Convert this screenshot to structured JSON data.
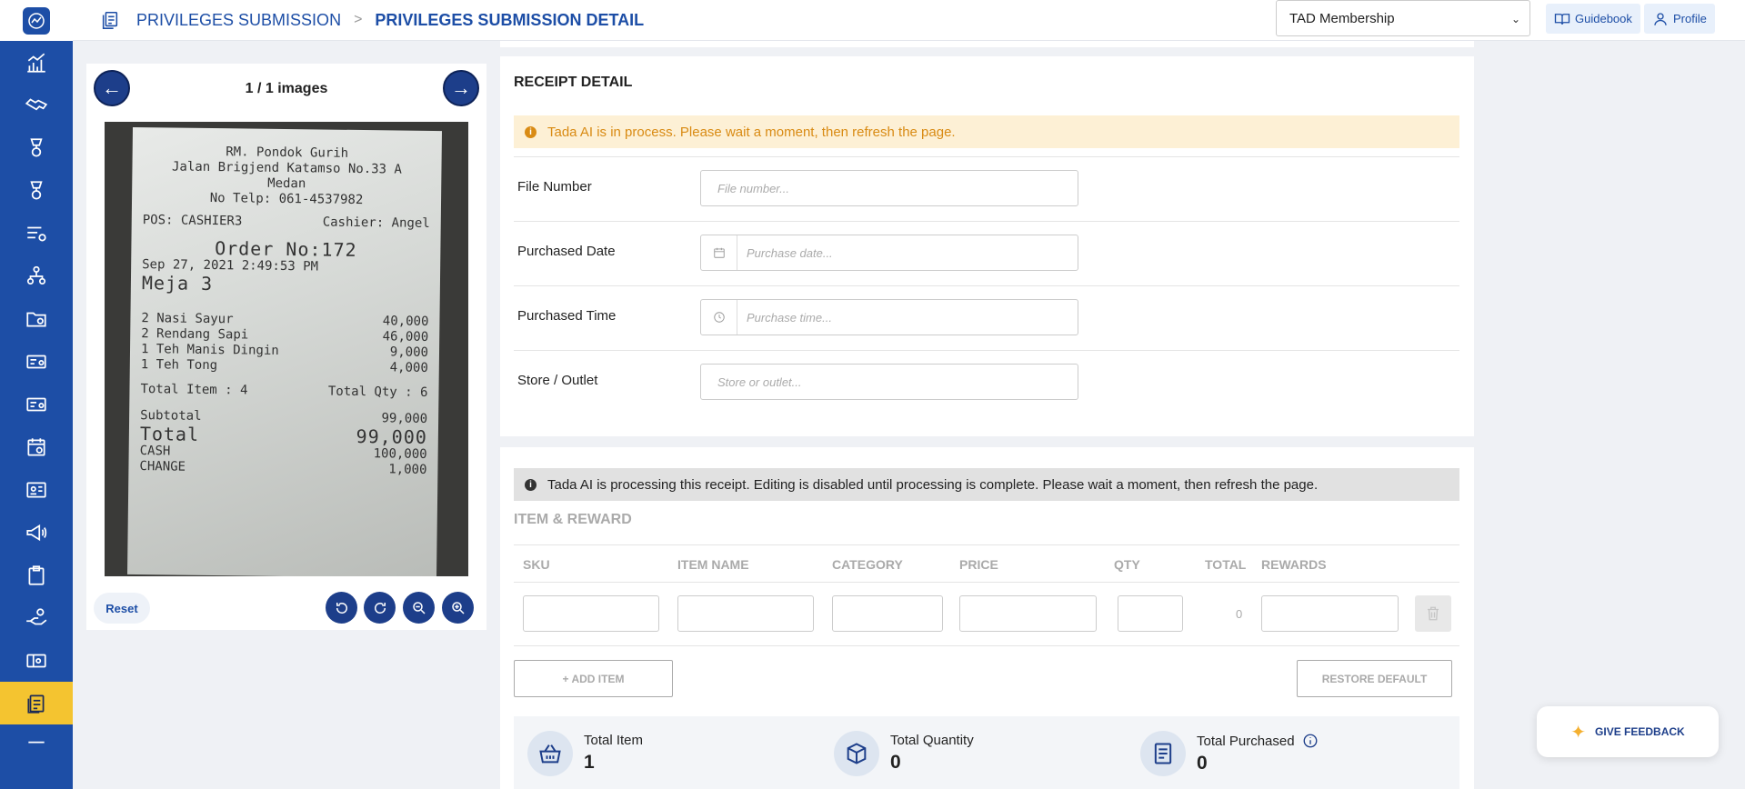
{
  "header": {
    "crumb1": "PRIVILEGES SUBMISSION",
    "separator": ">",
    "crumb2": "PRIVILEGES SUBMISSION DETAIL",
    "membership_selected": "TAD Membership",
    "guidebook_label": "Guidebook",
    "profile_label": "Profile"
  },
  "sidebar": {
    "items": [
      {
        "icon": "chart-icon"
      },
      {
        "icon": "handshake-icon"
      },
      {
        "icon": "award-icon"
      },
      {
        "icon": "trophy-icon"
      },
      {
        "icon": "list-settings-icon"
      },
      {
        "icon": "hierarchy-icon"
      },
      {
        "icon": "folder-settings-icon"
      },
      {
        "icon": "card-settings-icon"
      },
      {
        "icon": "card-star-icon"
      },
      {
        "icon": "calendar-settings-icon"
      },
      {
        "icon": "id-card-icon"
      },
      {
        "icon": "megaphone-icon"
      },
      {
        "icon": "clipboard-icon"
      },
      {
        "icon": "hand-coins-icon"
      },
      {
        "icon": "voucher-icon"
      },
      {
        "icon": "submission-icon",
        "active": true
      },
      {
        "icon": "more-icon"
      }
    ]
  },
  "image_viewer": {
    "count_label": "1 / 1 images",
    "reset_label": "Reset",
    "receipt_text": {
      "store": "RM. Pondok Gurih",
      "address": "Jalan Brigjend Katamso No.33 A",
      "city": "Medan",
      "phone": "No Telp: 061-4537982",
      "pos": "POS: CASHIER3",
      "cashier": "Cashier: Angel",
      "order": "Order No:172",
      "datetime": "Sep 27, 2021 2:49:53 PM",
      "table": "Meja 3",
      "lines": [
        {
          "item": "2 Nasi Sayur",
          "amount": "40,000"
        },
        {
          "item": "2 Rendang Sapi",
          "amount": "46,000"
        },
        {
          "item": "1 Teh Manis Dingin",
          "amount": "9,000"
        },
        {
          "item": "1 Teh Tong",
          "amount": "4,000"
        }
      ],
      "total_item": "Total Item : 4",
      "total_qty": "Total Qty : 6",
      "subtotal_label": "Subtotal",
      "subtotal": "99,000",
      "total_label": "Total",
      "total": "99,000",
      "cash_label": "CASH",
      "cash": "100,000",
      "change_label": "CHANGE",
      "change": "1,000"
    }
  },
  "receipt_detail": {
    "title": "RECEIPT DETAIL",
    "warning": "Tada AI is in process. Please wait a moment, then refresh the page.",
    "fields": {
      "file_number": {
        "label": "File Number",
        "placeholder": "File number..."
      },
      "purchased_date": {
        "label": "Purchased Date",
        "placeholder": "Purchase date..."
      },
      "purchased_time": {
        "label": "Purchased Time",
        "placeholder": "Purchase time..."
      },
      "store": {
        "label": "Store / Outlet",
        "placeholder": "Store or outlet..."
      }
    }
  },
  "items": {
    "note": "Tada AI is processing this receipt. Editing is disabled until processing is complete. Please wait a moment, then refresh the page.",
    "title": "ITEM & REWARD",
    "columns": {
      "sku": "SKU",
      "name": "ITEM NAME",
      "category": "CATEGORY",
      "price": "PRICE",
      "qty": "QTY",
      "total": "TOTAL",
      "rewards": "REWARDS"
    },
    "row_total": "0",
    "add_item_label": "+ ADD ITEM",
    "restore_label": "RESTORE DEFAULT"
  },
  "summary": {
    "total_item_label": "Total Item",
    "total_item_value": "1",
    "total_quantity_label": "Total Quantity",
    "total_quantity_value": "0",
    "total_purchased_label": "Total Purchased",
    "total_purchased_value": "0"
  },
  "feedback": {
    "label": "GIVE FEEDBACK"
  }
}
